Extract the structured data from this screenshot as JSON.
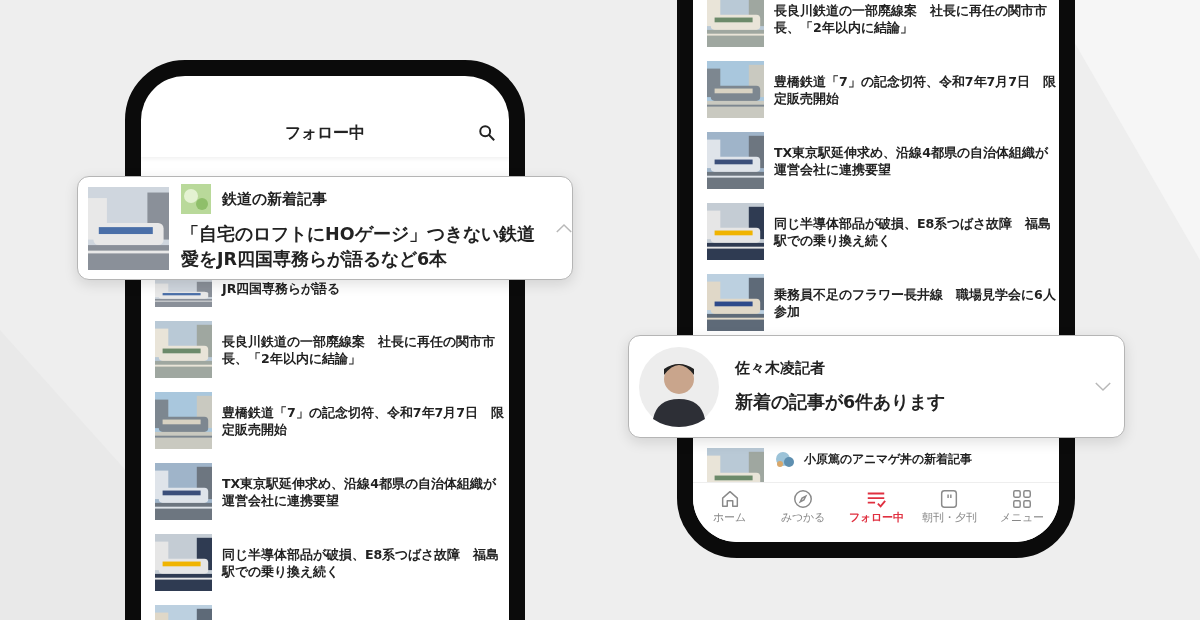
{
  "left_phone": {
    "header": {
      "title": "フォロー中"
    },
    "articles": [
      {
        "kind": "partial",
        "text": "JR四国専務らが語る"
      },
      {
        "kind": "article",
        "text": "長良川鉄道の一部廃線案　社長に再任の関市市長、「2年以内に結論」"
      },
      {
        "kind": "article",
        "text": "豊橋鉄道「7」の記念切符、令和7年7月7日　限定販売開始"
      },
      {
        "kind": "article",
        "text": "TX東京駅延伸求め、沿線4都県の自治体組織が運営会社に連携要望"
      },
      {
        "kind": "article",
        "text": "同じ半導体部品が破損、E8系つばさ故障　福島駅での乗り換え続く"
      },
      {
        "kind": "cut"
      }
    ]
  },
  "left_card": {
    "source": "鉄道の新着記事",
    "headline": "「自宅のロフトにHOゲージ」つきない鉄道愛をJR四国専務らが語るなど6本",
    "expanded": true
  },
  "right_phone": {
    "articles": [
      {
        "kind": "article",
        "text": "長良川鉄道の一部廃線案　社長に再任の関市市長、「2年以内に結論」"
      },
      {
        "kind": "article",
        "text": "豊橋鉄道「7」の記念切符、令和7年7月7日　限定販売開始"
      },
      {
        "kind": "article",
        "text": "TX東京駅延伸求め、沿線4都県の自治体組織が運営会社に連携要望"
      },
      {
        "kind": "article",
        "text": "同じ半導体部品が破損、E8系つばさ故障　福島駅での乗り換え続く"
      },
      {
        "kind": "article",
        "text": "乗務員不足のフラワー長井線　職場見学会に6人参加"
      },
      {
        "kind": "topic",
        "text": "小原篤のアニマゲ丼の新着記事"
      }
    ],
    "tabs": [
      {
        "label": "ホーム",
        "selected": false
      },
      {
        "label": "みつかる",
        "selected": false
      },
      {
        "label": "フォロー中",
        "selected": true
      },
      {
        "label": "朝刊・夕刊",
        "selected": false
      },
      {
        "label": "メニュー",
        "selected": false
      }
    ]
  },
  "right_card": {
    "name": "佐々木凌記者",
    "message": "新着の記事が6件あります",
    "expanded": false
  }
}
